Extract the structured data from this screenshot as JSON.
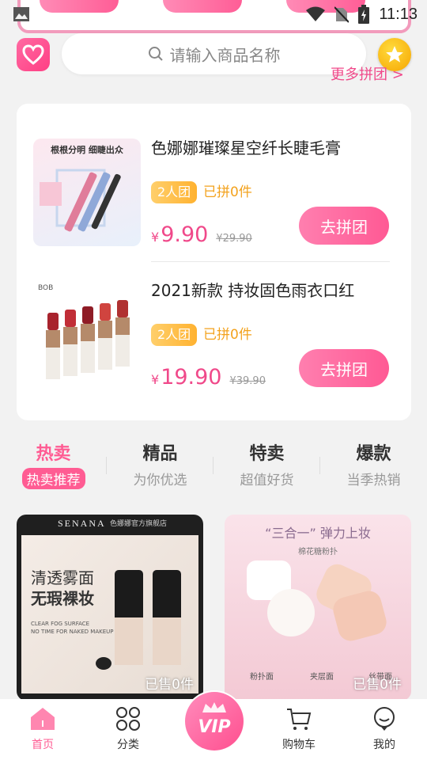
{
  "status_bar": {
    "time": "11:13"
  },
  "search": {
    "placeholder": "请输入商品名称"
  },
  "group_buy": {
    "more_label": "更多拼团 >",
    "items": [
      {
        "name": "色娜娜璀璨星空纤长睫毛膏",
        "thumb_caption": "根根分明 细睫出众",
        "tag": "2人团",
        "sold": "已拼0件",
        "currency": "¥",
        "price": "9.90",
        "old_price": "¥29.90",
        "button": "去拼团"
      },
      {
        "name": "2021新款 持妆固色雨衣口红",
        "thumb_caption": "BOB",
        "tag": "2人团",
        "sold": "已拼0件",
        "currency": "¥",
        "price": "19.90",
        "old_price": "¥39.90",
        "button": "去拼团"
      }
    ]
  },
  "tabs": [
    {
      "title": "热卖",
      "subtitle": "热卖推荐"
    },
    {
      "title": "精品",
      "subtitle": "为你优选"
    },
    {
      "title": "特卖",
      "subtitle": "超值好货"
    },
    {
      "title": "爆款",
      "subtitle": "当季热销"
    }
  ],
  "tiles": [
    {
      "brand": "SENANA",
      "store": "色娜娜官方旗舰店",
      "headline1": "清透雾面",
      "headline2": "无瑕裸妆",
      "sub": "CLEAR FOG SURFACE",
      "sub2": "NO TIME FOR NAKED MAKEUP",
      "sold": "已售0件"
    },
    {
      "headline": "“三合一” 弹力上妆",
      "sub": "棉花糖粉扑",
      "labels": [
        "粉扑面",
        "夹层面",
        "丝带面"
      ],
      "sold": "已售0件"
    }
  ],
  "bottom_nav": [
    {
      "label": "首页"
    },
    {
      "label": "分类"
    },
    {
      "label": "VIP"
    },
    {
      "label": "购物车"
    },
    {
      "label": "我的"
    }
  ],
  "colors": {
    "accent": "#ff5c93",
    "gold": "#f3a21d"
  }
}
